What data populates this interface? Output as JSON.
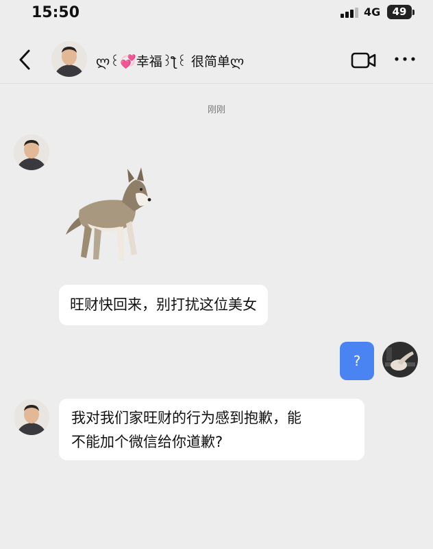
{
  "status_bar": {
    "time": "15:50",
    "network": "4G",
    "battery": "49"
  },
  "header": {
    "title": "ლ꒰💞幸福꒱ƪ꒰ 很简单ლ",
    "back_icon": "chevron-left-icon",
    "video_icon": "video-call-icon",
    "more_icon": "more-dots-icon"
  },
  "chat": {
    "timestamp": "刚刚",
    "messages": [
      {
        "sender": "other",
        "type": "sticker",
        "sticker": "husky-dog-sticker"
      },
      {
        "sender": "other",
        "type": "text",
        "text": "旺财快回来，别打扰这位美女"
      },
      {
        "sender": "me",
        "type": "text",
        "text": "?"
      },
      {
        "sender": "other",
        "type": "text",
        "lines": [
          "我对我们家旺财的行为感到抱歉，能",
          "不能加个微信给你道歉?"
        ]
      }
    ]
  },
  "colors": {
    "background": "#ededed",
    "bubble_other": "#ffffff",
    "bubble_me": "#4a84f2"
  }
}
